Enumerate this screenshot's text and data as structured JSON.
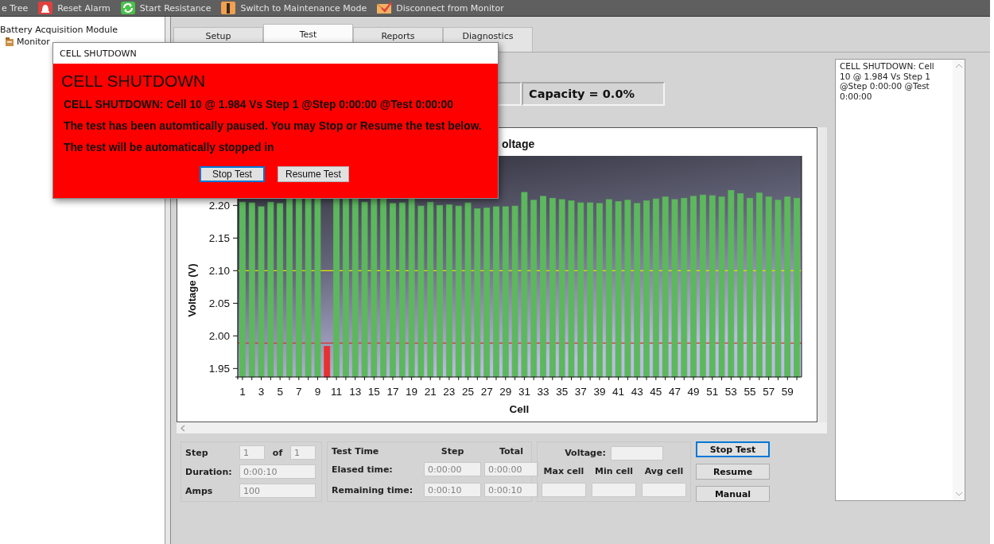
{
  "toolbar": {
    "items": [
      {
        "label": "e Tree",
        "kind": "text"
      },
      {
        "label": "Reset Alarm",
        "kind": "alarm"
      },
      {
        "label": "Start Resistance",
        "kind": "resistance"
      },
      {
        "label": "Switch to Maintenance Mode",
        "kind": "maintenance"
      },
      {
        "label": "Disconnect from Monitor",
        "kind": "disconnect"
      }
    ]
  },
  "tree": {
    "items": [
      {
        "label": "Battery Acquisition Module",
        "children": [
          {
            "label": "Monitor"
          }
        ]
      }
    ]
  },
  "tabs": [
    {
      "label": "Setup",
      "selected": false
    },
    {
      "label": "Test",
      "selected": true
    },
    {
      "label": "Reports",
      "selected": false
    },
    {
      "label": "Diagnostics",
      "selected": false
    }
  ],
  "readouts": {
    "capacity": "Capacity = 0.0%"
  },
  "chart": {
    "chart_data": {
      "type": "bar",
      "title": "oltage",
      "xlabel": "Cell",
      "ylabel": "Voltage (V)",
      "x": [
        1,
        2,
        3,
        4,
        5,
        6,
        7,
        8,
        9,
        10,
        11,
        12,
        13,
        14,
        15,
        16,
        17,
        18,
        19,
        20,
        21,
        22,
        23,
        24,
        25,
        26,
        27,
        28,
        29,
        30,
        31,
        32,
        33,
        34,
        35,
        36,
        37,
        38,
        39,
        40,
        41,
        42,
        43,
        44,
        45,
        46,
        47,
        48,
        49,
        50,
        51,
        52,
        53,
        54,
        55,
        56,
        57,
        58,
        59,
        60
      ],
      "series": [
        {
          "color": "#5cb85c",
          "values": [
            2.205,
            2.204,
            2.198,
            2.205,
            2.203,
            2.21,
            2.21,
            2.21,
            2.21,
            null,
            2.21,
            2.21,
            2.21,
            2.205,
            2.21,
            2.21,
            2.203,
            2.204,
            2.21,
            2.199,
            2.205,
            2.2,
            2.201,
            2.199,
            2.204,
            2.195,
            2.196,
            2.198,
            2.198,
            2.199,
            2.22,
            2.208,
            2.214,
            2.211,
            2.209,
            2.207,
            2.204,
            2.204,
            2.203,
            2.209,
            2.206,
            2.208,
            2.203,
            2.207,
            2.21,
            2.213,
            2.209,
            2.211,
            2.214,
            2.216,
            2.215,
            2.213,
            2.223,
            2.218,
            2.211,
            2.219,
            2.213,
            2.208,
            2.213,
            2.211
          ]
        },
        {
          "color": "#e83030",
          "values": [
            null,
            null,
            null,
            null,
            null,
            null,
            null,
            null,
            null,
            1.984,
            null,
            null,
            null,
            null,
            null,
            null,
            null,
            null,
            null,
            null,
            null,
            null,
            null,
            null,
            null,
            null,
            null,
            null,
            null,
            null,
            null,
            null,
            null,
            null,
            null,
            null,
            null,
            null,
            null,
            null,
            null,
            null,
            null,
            null,
            null,
            null,
            null,
            null,
            null,
            null,
            null,
            null,
            null,
            null,
            null,
            null,
            null,
            null,
            null,
            null
          ]
        }
      ],
      "xlim": [
        0.5,
        60.5
      ],
      "ylim": [
        1.937,
        2.276
      ],
      "yticks": [
        {
          "value": 1.95,
          "label": "1.95"
        },
        {
          "value": 2.0,
          "label": "2.00"
        },
        {
          "value": 2.05,
          "label": "2.05"
        },
        {
          "value": 2.1,
          "label": "2.10"
        },
        {
          "value": 2.15,
          "label": "2.15"
        },
        {
          "value": 2.2,
          "label": "2.20"
        }
      ],
      "xticks": [
        1,
        3,
        5,
        7,
        9,
        11,
        13,
        15,
        17,
        19,
        21,
        23,
        25,
        27,
        29,
        31,
        33,
        35,
        37,
        39,
        41,
        43,
        45,
        47,
        49,
        51,
        53,
        55,
        57,
        59
      ],
      "ref_lines": [
        {
          "axis": "y",
          "value": 2.1,
          "color": "#e6e600"
        },
        {
          "axis": "y",
          "value": 1.989,
          "color": "#d83030"
        }
      ]
    }
  },
  "log": {
    "text": "CELL SHUTDOWN: Cell 10 @ 1.984 Vs Step 1 @Step 0:00:00 @Test 0:00:00"
  },
  "step_panel": {
    "step_label": "Step",
    "step": "1",
    "of_label": "of",
    "of": "1",
    "duration_label": "Duration:",
    "duration": "0:00:10",
    "amps_label": "Amps",
    "amps": "100"
  },
  "time_panel": {
    "title": "Test Time",
    "col_step": "Step",
    "col_total": "Total",
    "rows": [
      {
        "label": "Elased time:",
        "step": "0:00:00",
        "total": "0:00:00"
      },
      {
        "label": "Remaining time:",
        "step": "0:00:10",
        "total": "0:00:10"
      }
    ]
  },
  "voltage_panel": {
    "voltage_label": "Voltage:",
    "cells": [
      {
        "label": "Max cell"
      },
      {
        "label": "Min cell"
      },
      {
        "label": "Avg cell"
      }
    ]
  },
  "buttons": [
    {
      "label": "Stop Test",
      "focused": true
    },
    {
      "label": "Resume",
      "focused": false
    },
    {
      "label": "Manual",
      "focused": false
    }
  ],
  "dialog": {
    "title": "CELL SHUTDOWN",
    "heading": "CELL SHUTDOWN",
    "lines": [
      "CELL SHUTDOWN: Cell 10 @ 1.984 Vs Step 1 @Step 0:00:00 @Test 0:00:00",
      "The test has been automtically paused. You may Stop or Resume the test below.",
      "The test will be automatically stopped in"
    ],
    "buttons": [
      {
        "label": "Stop Test",
        "focused": true
      },
      {
        "label": "Resume Test",
        "focused": false
      }
    ]
  }
}
